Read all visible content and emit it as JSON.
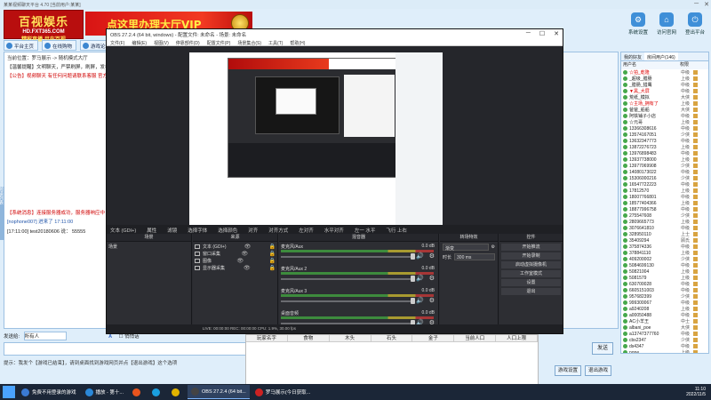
{
  "app": {
    "title": "某某视频聊天平台 4.70 [当前用户:某某]",
    "logo_line1": "百视娱乐",
    "logo_line2": "HD.FXT365.COM",
    "logo_line3": "精彩直播 尽在百视",
    "banner_text": "点这里办理大厅VIP",
    "nav": [
      "平台主页",
      "在线购物",
      "游戏论坛"
    ],
    "tools": [
      {
        "label": "系统设置",
        "icon": "gear-icon"
      },
      {
        "label": "访问官网",
        "icon": "home-icon"
      },
      {
        "label": "登出平台",
        "icon": "logout-icon"
      }
    ],
    "room_line": "当前位置：罗马展示 -> 随机模式大厅",
    "chat": [
      {
        "text": "【温馨提醒】文明聊天，严禁刷屏，刷屏，发布广告...",
        "color": "#222"
      },
      {
        "text": "【公告】视频聊天 有任何问题请联系客服 官方网址：http://hd.fxt365.com",
        "color": "#d00000"
      },
      {
        "text": "【系统消息】连接服务器成功，服务器响应中 17:10:57",
        "color": "#d00000"
      },
      {
        "text": "[nophone007] 进来了 17:11:00",
        "color": "#2255aa"
      },
      {
        "text": "[17:11:00] test20180606 说： 55555",
        "color": "#222"
      }
    ],
    "side_tab": "频道列表",
    "send_to_label": "发送给:",
    "send_to_value": "所有人",
    "private_label": "悄悄话",
    "send_button": "发送",
    "tip": "提示：我发个【游戏已结束】，请到桌面找到游戏网页并点【退出游戏】这个选项",
    "bottom_buttons": [
      "游戏设置",
      "退出游戏"
    ]
  },
  "users": {
    "tabs": [
      "我的好友",
      "房间用户(146)"
    ],
    "headers": [
      "用户名",
      "权限"
    ],
    "list": [
      {
        "name": "☆拍_乾隆",
        "role": "中级",
        "red": true
      },
      {
        "name": "_超级_腊肠",
        "role": "上级",
        "red": false
      },
      {
        "name": "_腊肠_猎鹰",
        "role": "中级",
        "red": false
      },
      {
        "name": "▼黑_大屏",
        "role": "中级",
        "red": true
      },
      {
        "name": "荒纸_模拟",
        "role": "大侠",
        "red": false
      },
      {
        "name": "☆主场_拥有了",
        "role": "上级",
        "red": true
      },
      {
        "name": "爸爸_船船",
        "role": "大侠",
        "red": false
      },
      {
        "name": "阿铁铺子小店",
        "role": "中级",
        "red": false
      },
      {
        "name": "☆元哥",
        "role": "上级",
        "red": false
      },
      {
        "name": "13366308616",
        "role": "中级",
        "red": false
      },
      {
        "name": "13574167051",
        "role": "少侠",
        "red": false
      },
      {
        "name": "13632347773",
        "role": "中级",
        "red": false
      },
      {
        "name": "13872276723",
        "role": "上级",
        "red": false
      },
      {
        "name": "13976898483",
        "role": "中级",
        "red": false
      },
      {
        "name": "13937738000",
        "role": "上级",
        "red": false
      },
      {
        "name": "13977069908",
        "role": "少侠",
        "red": false
      },
      {
        "name": "14080173022",
        "role": "中级",
        "red": false
      },
      {
        "name": "15306000216",
        "role": "少侠",
        "red": false
      },
      {
        "name": "16547722223",
        "role": "中级",
        "red": false
      },
      {
        "name": "17812570",
        "role": "上级",
        "red": false
      },
      {
        "name": "18007766801",
        "role": "中级",
        "red": false
      },
      {
        "name": "18577404366",
        "role": "上级",
        "red": false
      },
      {
        "name": "18877996758",
        "role": "中级",
        "red": false
      },
      {
        "name": "275547608",
        "role": "少侠",
        "red": false
      },
      {
        "name": "2809665773",
        "role": "上级",
        "red": false
      },
      {
        "name": "3076641810",
        "role": "中级",
        "red": false
      },
      {
        "name": "328950110",
        "role": "上士",
        "red": false
      },
      {
        "name": "35409294",
        "role": "顾氏",
        "red": false
      },
      {
        "name": "375874336",
        "role": "中级",
        "red": false
      },
      {
        "name": "378841110",
        "role": "上级",
        "red": false
      },
      {
        "name": "409200002",
        "role": "少侠",
        "red": false
      },
      {
        "name": "5084699130",
        "role": "中级",
        "red": false
      },
      {
        "name": "50821004",
        "role": "上级",
        "red": false
      },
      {
        "name": "5081579",
        "role": "上级",
        "red": false
      },
      {
        "name": "630700028",
        "role": "中级",
        "red": false
      },
      {
        "name": "6605151003",
        "role": "中级",
        "red": false
      },
      {
        "name": "957682399",
        "role": "少侠",
        "red": false
      },
      {
        "name": "999300067",
        "role": "中级",
        "red": false
      },
      {
        "name": "a9240208",
        "role": "上级",
        "red": false
      },
      {
        "name": "a00050488",
        "role": "中级",
        "red": false
      },
      {
        "name": "AC小羊王",
        "role": "中士",
        "red": false
      },
      {
        "name": "albani_poe",
        "role": "大侠",
        "red": false
      },
      {
        "name": "a13747377760",
        "role": "中级",
        "red": false
      },
      {
        "name": "cbs2347",
        "role": "少侠",
        "red": false
      },
      {
        "name": "ds4347",
        "role": "中级",
        "red": false
      },
      {
        "name": "none",
        "role": "上级",
        "red": false
      },
      {
        "name": "a100000000",
        "role": "中级",
        "red": false
      },
      {
        "name": "ZX米那",
        "role": "上级",
        "red": false
      },
      {
        "name": "阿Q-乐雨晴晴",
        "role": "上级",
        "red": false
      }
    ]
  },
  "obs": {
    "title": "OBS 27.2.4 (64 bit, windows) - 配置文件: 未命名 - 场景: 未命名",
    "menu": [
      "文件(F)",
      "编辑(E)",
      "视图(V)",
      "停靠部件(D)",
      "配置文件(P)",
      "场景集合(S)",
      "工具(T)",
      "帮助(H)"
    ],
    "source_toolbar": [
      "文本 (GDI+)",
      "属性",
      "滤镜",
      "选择字体",
      "选择颜色",
      "对齐",
      "对齐方式",
      "左对齐",
      "水平对齐",
      "左一 水平",
      "飞行 上右"
    ],
    "preview_overlay": "小新开始直播啦",
    "docks": {
      "scenes": {
        "title": "场景",
        "items": [
          "场景"
        ]
      },
      "sources": {
        "title": "来源",
        "items": [
          "文本 (GDI+)",
          "窗口采集",
          "图像",
          "显示器采集"
        ]
      },
      "mixer": {
        "title": "混音器",
        "rows": [
          {
            "name": "麦克风/Aux",
            "db": "0.0 dB"
          },
          {
            "name": "麦克风/Aux 2",
            "db": "0.0 dB"
          },
          {
            "name": "麦克风/Aux 3",
            "db": "0.0 dB"
          },
          {
            "name": "桌面音频",
            "db": "0.0 dB"
          }
        ]
      },
      "transitions": {
        "title": "转场特效",
        "type": "渐变",
        "duration_label": "时长",
        "duration": "300 ms"
      },
      "controls": {
        "title": "控件",
        "buttons": [
          "开始推流",
          "开始录制",
          "启动虚拟摄像机",
          "工作室模式",
          "设置",
          "退出"
        ]
      }
    },
    "status": "LIVE: 00:00:00   REC: 00:00:00   CPU: 1.9%, 30.00 fps"
  },
  "table": {
    "headers": [
      "玩家名字",
      "食物",
      "木头",
      "石头",
      "金子",
      "当前人口",
      "人口上限"
    ]
  },
  "taskbar": {
    "items": [
      {
        "label": "免费不用登录的游戏",
        "color": "#3a7ad4",
        "active": false
      },
      {
        "label": "播放 - 第十...",
        "color": "#2b88d8",
        "active": false
      },
      {
        "label": "",
        "color": "#e8541d",
        "active": false
      },
      {
        "label": "",
        "color": "#1a9fe0",
        "active": false
      },
      {
        "label": "",
        "color": "#e2b400",
        "active": false
      },
      {
        "label": "OBS 27.2.4 (64 bit...",
        "color": "#444",
        "active": true
      },
      {
        "label": "罗马展示(今日获取...",
        "color": "#cc2222",
        "active": false
      }
    ],
    "time": "11:10",
    "date": "2022/11/5"
  }
}
